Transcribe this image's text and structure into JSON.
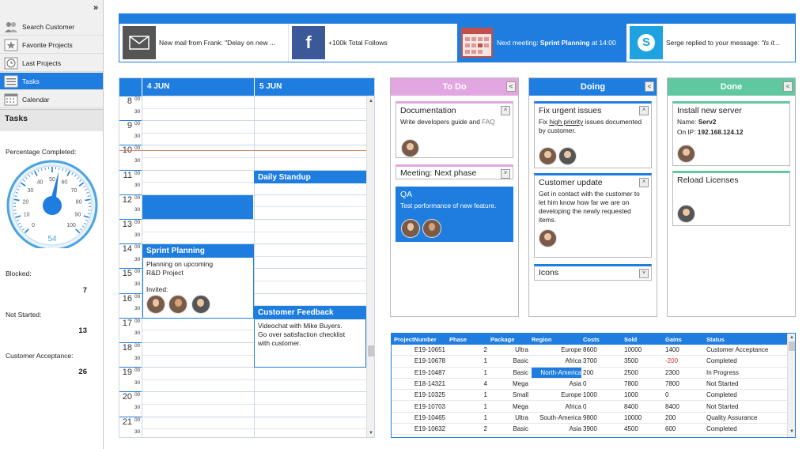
{
  "sidebar": {
    "collapse_glyph": "»",
    "items": [
      {
        "label": "Search Customer",
        "icon": "users-icon"
      },
      {
        "label": "Favorite Projects",
        "icon": "star-icon"
      },
      {
        "label": "Last Projects",
        "icon": "clock-icon"
      },
      {
        "label": "Tasks",
        "icon": "tasks-icon",
        "active": true
      },
      {
        "label": "Calendar",
        "icon": "calendar-icon"
      }
    ],
    "section_title": "Tasks",
    "percentage_label": "Percentage Completed:",
    "gauge": {
      "value": 54,
      "ticks": [
        "0",
        "10",
        "20",
        "30",
        "40",
        "50",
        "60",
        "70",
        "80",
        "90",
        "100"
      ]
    },
    "stats": [
      {
        "label": "Blocked:",
        "value": "7"
      },
      {
        "label": "Not Started:",
        "value": "13"
      },
      {
        "label": "Customer Acceptance:",
        "value": "26"
      }
    ]
  },
  "notifications": [
    {
      "icon": "mail-icon",
      "text": "New mail from Frank: \"Delay on new ..."
    },
    {
      "icon": "facebook-icon",
      "glyph": "f",
      "text": "+100k Total Follows"
    },
    {
      "icon": "calendar-icon",
      "prefix": "Next meeting: ",
      "bold": "Sprint Planning",
      "suffix": " at 14:00"
    },
    {
      "icon": "skype-icon",
      "glyph": "S",
      "prefix": "Serge replied to your message: ",
      "italic": "\"Is it..."
    }
  ],
  "calendar": {
    "days": [
      "4 JUN",
      "5 JUN"
    ],
    "hours": [
      "8",
      "9",
      "10",
      "11",
      "12",
      "13",
      "14",
      "15",
      "16",
      "17",
      "18",
      "19",
      "20",
      "21"
    ],
    "minute_labels": [
      "00",
      "30"
    ],
    "appointments": {
      "sprint": {
        "title": "Sprint Planning",
        "body1": "Planning on upcoming",
        "body2": "R&D Project",
        "invited": "Invited:"
      },
      "standup": {
        "title": "Daily Standup"
      },
      "feedback": {
        "title": "Customer Feedback",
        "body1": "Videochat with Mike Buyers.",
        "body2": "Go over satisfaction checklist",
        "body3": "with customer."
      }
    }
  },
  "kanban": {
    "todo": {
      "title": "To Do",
      "color": "#e2a6e0",
      "cards": {
        "doc": {
          "title": "Documentation",
          "body": "Write developers guide and ",
          "link": "FAQ"
        },
        "meeting": {
          "title": "Meeting: Next phase"
        },
        "qa": {
          "title": "QA",
          "body": "Test performance of new feature."
        }
      }
    },
    "doing": {
      "title": "Doing",
      "color": "#1f7de0",
      "cards": {
        "urgent": {
          "title": "Fix urgent issues",
          "body_pre": "Fix ",
          "body_u": "high priority",
          "body_post": " issues documented by customer."
        },
        "update": {
          "title": "Customer update",
          "body": "Get in contact with the customer to let him know how far we are on developing the newly requested items."
        },
        "icons": {
          "title": "Icons"
        }
      }
    },
    "done": {
      "title": "Done",
      "color": "#5fc8a0",
      "cards": {
        "server": {
          "title": "Install new server",
          "name_label": "Name: ",
          "name_value": "Serv2",
          "ip_label": "On IP: ",
          "ip_value": "192.168.124.12"
        },
        "licenses": {
          "title": "Reload Licenses"
        }
      }
    }
  },
  "grid": {
    "columns": [
      "ProjectNumber",
      "Phase",
      "Package",
      "Region",
      "Costs",
      "Sold",
      "Gains",
      "Status"
    ],
    "rows": [
      [
        "E19-10651",
        "2",
        "Ultra",
        "Europe",
        "8600",
        "10000",
        "1400",
        "Customer Acceptance"
      ],
      [
        "E19-10678",
        "1",
        "Basic",
        "Africa",
        "3700",
        "3500",
        "-200",
        "Completed"
      ],
      [
        "E19-10487",
        "1",
        "Basic",
        "North-America",
        "200",
        "2500",
        "2300",
        "In Progress"
      ],
      [
        "E18-14321",
        "4",
        "Mega",
        "Asia",
        "0",
        "7800",
        "7800",
        "Not Started"
      ],
      [
        "E19-10325",
        "1",
        "Small",
        "Europe",
        "1000",
        "1000",
        "0",
        "Completed"
      ],
      [
        "E19-10703",
        "1",
        "Mega",
        "Africa",
        "0",
        "8400",
        "8400",
        "Not Started"
      ],
      [
        "E19-10465",
        "1",
        "Ultra",
        "South-America",
        "9800",
        "10000",
        "200",
        "Quality Assurance"
      ],
      [
        "E19-10632",
        "2",
        "Basic",
        "Asia",
        "3900",
        "4500",
        "600",
        "Completed"
      ]
    ],
    "negative_color": "#e03030",
    "accent": "#1f7de0"
  }
}
